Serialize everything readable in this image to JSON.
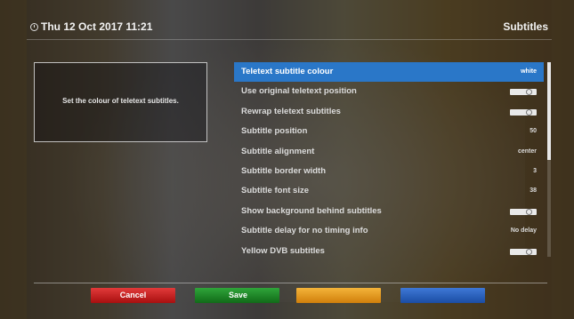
{
  "header": {
    "datetime": "Thu 12 Oct 2017  11:21",
    "title": "Subtitles",
    "clock_icon": "clock-icon"
  },
  "help": {
    "text": "Set the colour of teletext subtitles."
  },
  "menu": {
    "items": [
      {
        "label": "Teletext subtitle colour",
        "value": "white",
        "type": "value",
        "selected": true
      },
      {
        "label": "Use original teletext position",
        "type": "toggle",
        "state": "off"
      },
      {
        "label": "Rewrap teletext subtitles",
        "type": "toggle",
        "state": "off"
      },
      {
        "label": "Subtitle position",
        "value": "50",
        "type": "value"
      },
      {
        "label": "Subtitle alignment",
        "value": "center",
        "type": "value"
      },
      {
        "label": "Subtitle border width",
        "value": "3",
        "type": "value"
      },
      {
        "label": "Subtitle font size",
        "value": "38",
        "type": "value"
      },
      {
        "label": "Show background behind subtitles",
        "type": "toggle",
        "state": "off"
      },
      {
        "label": "Subtitle delay for no timing info",
        "value": "No delay",
        "type": "value"
      },
      {
        "label": "Yellow DVB subtitles",
        "type": "toggle",
        "state": "off"
      }
    ]
  },
  "buttons": {
    "red": "Cancel",
    "green": "Save",
    "yellow": "",
    "blue": ""
  },
  "colors": {
    "selection": "#2a77c8",
    "red": "#c42222",
    "green": "#1f8a2a",
    "yellow": "#e89a1f",
    "blue": "#2c62c0"
  }
}
